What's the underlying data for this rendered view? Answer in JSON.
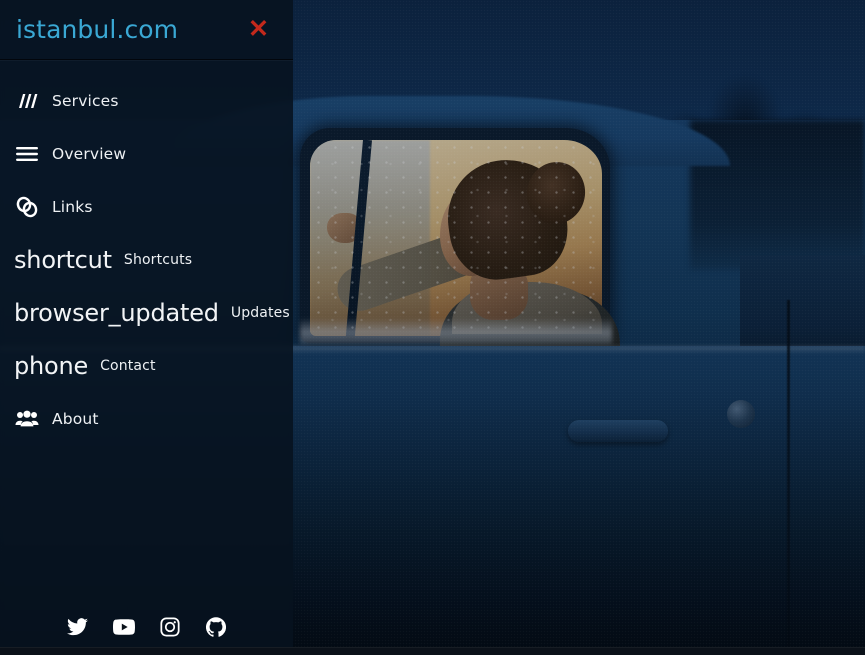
{
  "sidebar": {
    "brand": "istanbul.com",
    "close_label": "✕",
    "accent_color": "#3aa8d4",
    "close_color": "#c3291c",
    "nav": [
      {
        "icon": "sort-slanted-icon",
        "icon_text": "",
        "label": "Services"
      },
      {
        "icon": "menu-hamburger-icon",
        "icon_text": "",
        "label": "Overview"
      },
      {
        "icon": "link-chain-icon",
        "icon_text": "",
        "label": "Links"
      },
      {
        "icon": "shortcut-icon",
        "icon_text": "shortcut",
        "label": "Shortcuts"
      },
      {
        "icon": "browser-updated-icon",
        "icon_text": "browser_updated",
        "label": "Updates"
      },
      {
        "icon": "phone-icon",
        "icon_text": "phone",
        "label": "Contact"
      },
      {
        "icon": "groups-icon",
        "icon_text": "",
        "label": "About"
      }
    ],
    "socials": [
      {
        "icon": "twitter-icon",
        "label": "Twitter"
      },
      {
        "icon": "youtube-icon",
        "label": "YouTube"
      },
      {
        "icon": "instagram-icon",
        "label": "Instagram"
      },
      {
        "icon": "github-icon",
        "label": "GitHub"
      }
    ]
  },
  "background": {
    "description": "Woman seated inside an old blue pickup truck at dusk, seen through the side window"
  }
}
